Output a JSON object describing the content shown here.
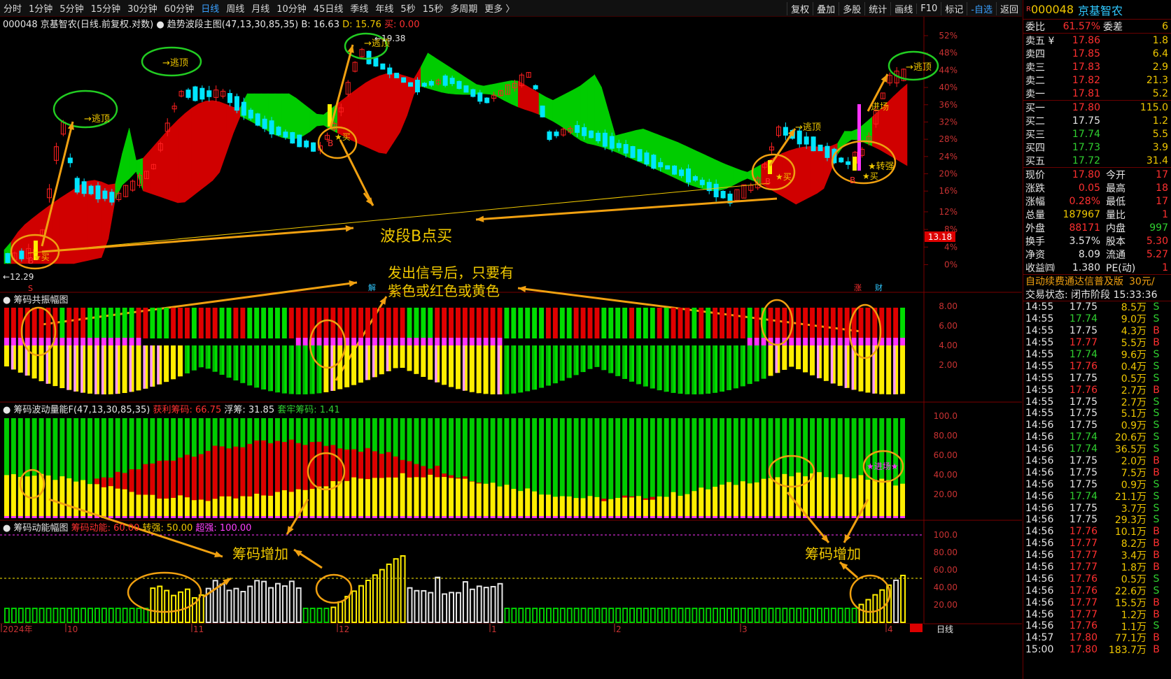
{
  "toolbar": {
    "timeframes": [
      "分时",
      "1分钟",
      "5分钟",
      "15分钟",
      "30分钟",
      "60分钟",
      "日线",
      "周线",
      "月线",
      "10分钟",
      "45日线",
      "季线",
      "年线",
      "5秒",
      "15秒",
      "多周期",
      "更多 〉"
    ],
    "active": "日线",
    "right_buttons": [
      "复权",
      "叠加",
      "多股",
      "统计",
      "画线",
      "F10",
      "标记",
      "-自选",
      "返回"
    ]
  },
  "main": {
    "stock_code": "000048",
    "stock_name": "京基智农",
    "header_prefix": "000048 京基智农(日线.前复权.对数)",
    "indicator": "趋势波段主图(47,13,30,85,35)",
    "b_label": "B: 16.63",
    "d_label": "D: 15.76",
    "buy_label": "买: 0.00",
    "high_label": "19.38",
    "low_label": "12.29",
    "current_price_tag": "13.18",
    "pct_axis": [
      "52%",
      "48%",
      "44%",
      "40%",
      "36%",
      "32%",
      "28%",
      "24%",
      "20%",
      "16%",
      "12%",
      "8%",
      "4%",
      "0%"
    ],
    "annotations": {
      "escape": "逃顶",
      "buy": "买",
      "star_buy": "★买",
      "b": "B",
      "enter": "进场",
      "turn_strong": "★转强",
      "wave_buy": "波段B点买",
      "signal_line1": "发出信号后，只要有",
      "signal_line2": "紫色或红色或黄色",
      "s_mark": "S",
      "jie": "解",
      "zhang": "涨",
      "cai": "财"
    }
  },
  "panel1": {
    "title": "筹码共振幅图",
    "axis": [
      "8.00",
      "6.00",
      "4.00",
      "2.00"
    ]
  },
  "panel2": {
    "title": "筹码波动量能F(47,13,30,85,35)",
    "profit_label": "获利筹码: 66.75",
    "float_label": "浮筹: 31.85",
    "locked_label": "套牢筹码: 1.41",
    "axis": [
      "100.0",
      "80.00",
      "60.00",
      "40.00",
      "20.00"
    ],
    "enter_tag": "★进场★"
  },
  "panel3": {
    "title": "筹码动能幅图",
    "kinetic_label": "筹码动能: 60.00",
    "turn_label": "转强: 50.00",
    "super_label": "超强: 100.00",
    "axis": [
      "100.0",
      "80.00",
      "60.00",
      "40.00",
      "20.00"
    ],
    "increase": "筹码增加"
  },
  "date_axis": {
    "labels": [
      "2024年",
      "10",
      "11",
      "12",
      "1",
      "2",
      "3",
      "4"
    ],
    "period": "日线"
  },
  "colors": {
    "bg": "#000000",
    "up": "#ff2020",
    "down": "#00e5ff",
    "green": "#00dd00",
    "red": "#dd0000",
    "yellow": "#ffee00",
    "magenta": "#ff33ff",
    "accent": "#f0a010"
  },
  "quote": {
    "code": "000048",
    "name": "京基智农",
    "weibi": {
      "label": "委比",
      "value": "61.57%",
      "diff_label": "委差",
      "diff": "6"
    },
    "asks": [
      {
        "label": "卖五 ¥",
        "price": "17.86",
        "vol": "1.8"
      },
      {
        "label": "卖四",
        "price": "17.85",
        "vol": "6.4"
      },
      {
        "label": "卖三",
        "price": "17.83",
        "vol": "2.9"
      },
      {
        "label": "卖二",
        "price": "17.82",
        "vol": "21.3"
      },
      {
        "label": "卖一",
        "price": "17.81",
        "vol": "5.2"
      }
    ],
    "bids": [
      {
        "label": "买一",
        "price": "17.80",
        "vol": "115.0"
      },
      {
        "label": "买二",
        "price": "17.75",
        "vol": "1.2"
      },
      {
        "label": "买三",
        "price": "17.74",
        "vol": "5.5"
      },
      {
        "label": "买四",
        "price": "17.73",
        "vol": "3.9"
      },
      {
        "label": "买五",
        "price": "17.72",
        "vol": "31.4"
      }
    ],
    "stats": [
      {
        "l1": "现价",
        "v1": "17.80",
        "l2": "今开",
        "v2": "17"
      },
      {
        "l1": "涨跌",
        "v1": "0.05",
        "l2": "最高",
        "v2": "18"
      },
      {
        "l1": "涨幅",
        "v1": "0.28%",
        "l2": "最低",
        "v2": "17"
      },
      {
        "l1": "总量",
        "v1": "187967",
        "l2": "量比",
        "v2": "1"
      },
      {
        "l1": "外盘",
        "v1": "88171",
        "l2": "内盘",
        "v2": "997"
      },
      {
        "l1": "换手",
        "v1": "3.57%",
        "l2": "股本",
        "v2": "5.30"
      },
      {
        "l1": "净资",
        "v1": "8.09",
        "l2": "流通",
        "v2": "5.27"
      },
      {
        "l1": "收益㈣",
        "v1": "1.380",
        "l2": "PE(动)",
        "v2": "1"
      }
    ],
    "promo": "自动续费通达信普及版",
    "promo_price": "30元/",
    "trade_state": "交易状态: 闭市阶段 15:33:36",
    "ticks": [
      [
        "14:55",
        "17.75",
        "8.5万",
        "S"
      ],
      [
        "14:55",
        "17.74",
        "9.0万",
        "S"
      ],
      [
        "14:55",
        "17.75",
        "4.3万",
        "B"
      ],
      [
        "14:55",
        "17.77",
        "5.5万",
        "B"
      ],
      [
        "14:55",
        "17.74",
        "9.6万",
        "S"
      ],
      [
        "14:55",
        "17.76",
        "0.4万",
        "S"
      ],
      [
        "14:55",
        "17.75",
        "0.5万",
        "S"
      ],
      [
        "14:55",
        "17.76",
        "2.7万",
        "B"
      ],
      [
        "14:55",
        "17.75",
        "2.7万",
        "S"
      ],
      [
        "14:55",
        "17.75",
        "5.1万",
        "S"
      ],
      [
        "14:56",
        "17.75",
        "0.9万",
        "S"
      ],
      [
        "14:56",
        "17.74",
        "20.6万",
        "S"
      ],
      [
        "14:56",
        "17.74",
        "36.5万",
        "S"
      ],
      [
        "14:56",
        "17.75",
        "2.0万",
        "B"
      ],
      [
        "14:56",
        "17.75",
        "7.5万",
        "B"
      ],
      [
        "14:56",
        "17.75",
        "0.9万",
        "S"
      ],
      [
        "14:56",
        "17.74",
        "21.1万",
        "S"
      ],
      [
        "14:56",
        "17.75",
        "3.7万",
        "S"
      ],
      [
        "14:56",
        "17.75",
        "29.3万",
        "S"
      ],
      [
        "14:56",
        "17.76",
        "10.1万",
        "B"
      ],
      [
        "14:56",
        "17.77",
        "8.2万",
        "B"
      ],
      [
        "14:56",
        "17.77",
        "3.4万",
        "B"
      ],
      [
        "14:56",
        "17.77",
        "1.8万",
        "B"
      ],
      [
        "14:56",
        "17.76",
        "0.5万",
        "S"
      ],
      [
        "14:56",
        "17.76",
        "22.6万",
        "S"
      ],
      [
        "14:56",
        "17.77",
        "15.5万",
        "B"
      ],
      [
        "14:56",
        "17.77",
        "1.2万",
        "B"
      ],
      [
        "14:56",
        "17.76",
        "1.1万",
        "S"
      ],
      [
        "14:57",
        "17.80",
        "77.1万",
        "B"
      ],
      [
        "15:00",
        "17.80",
        "183.7万",
        "B"
      ]
    ]
  }
}
